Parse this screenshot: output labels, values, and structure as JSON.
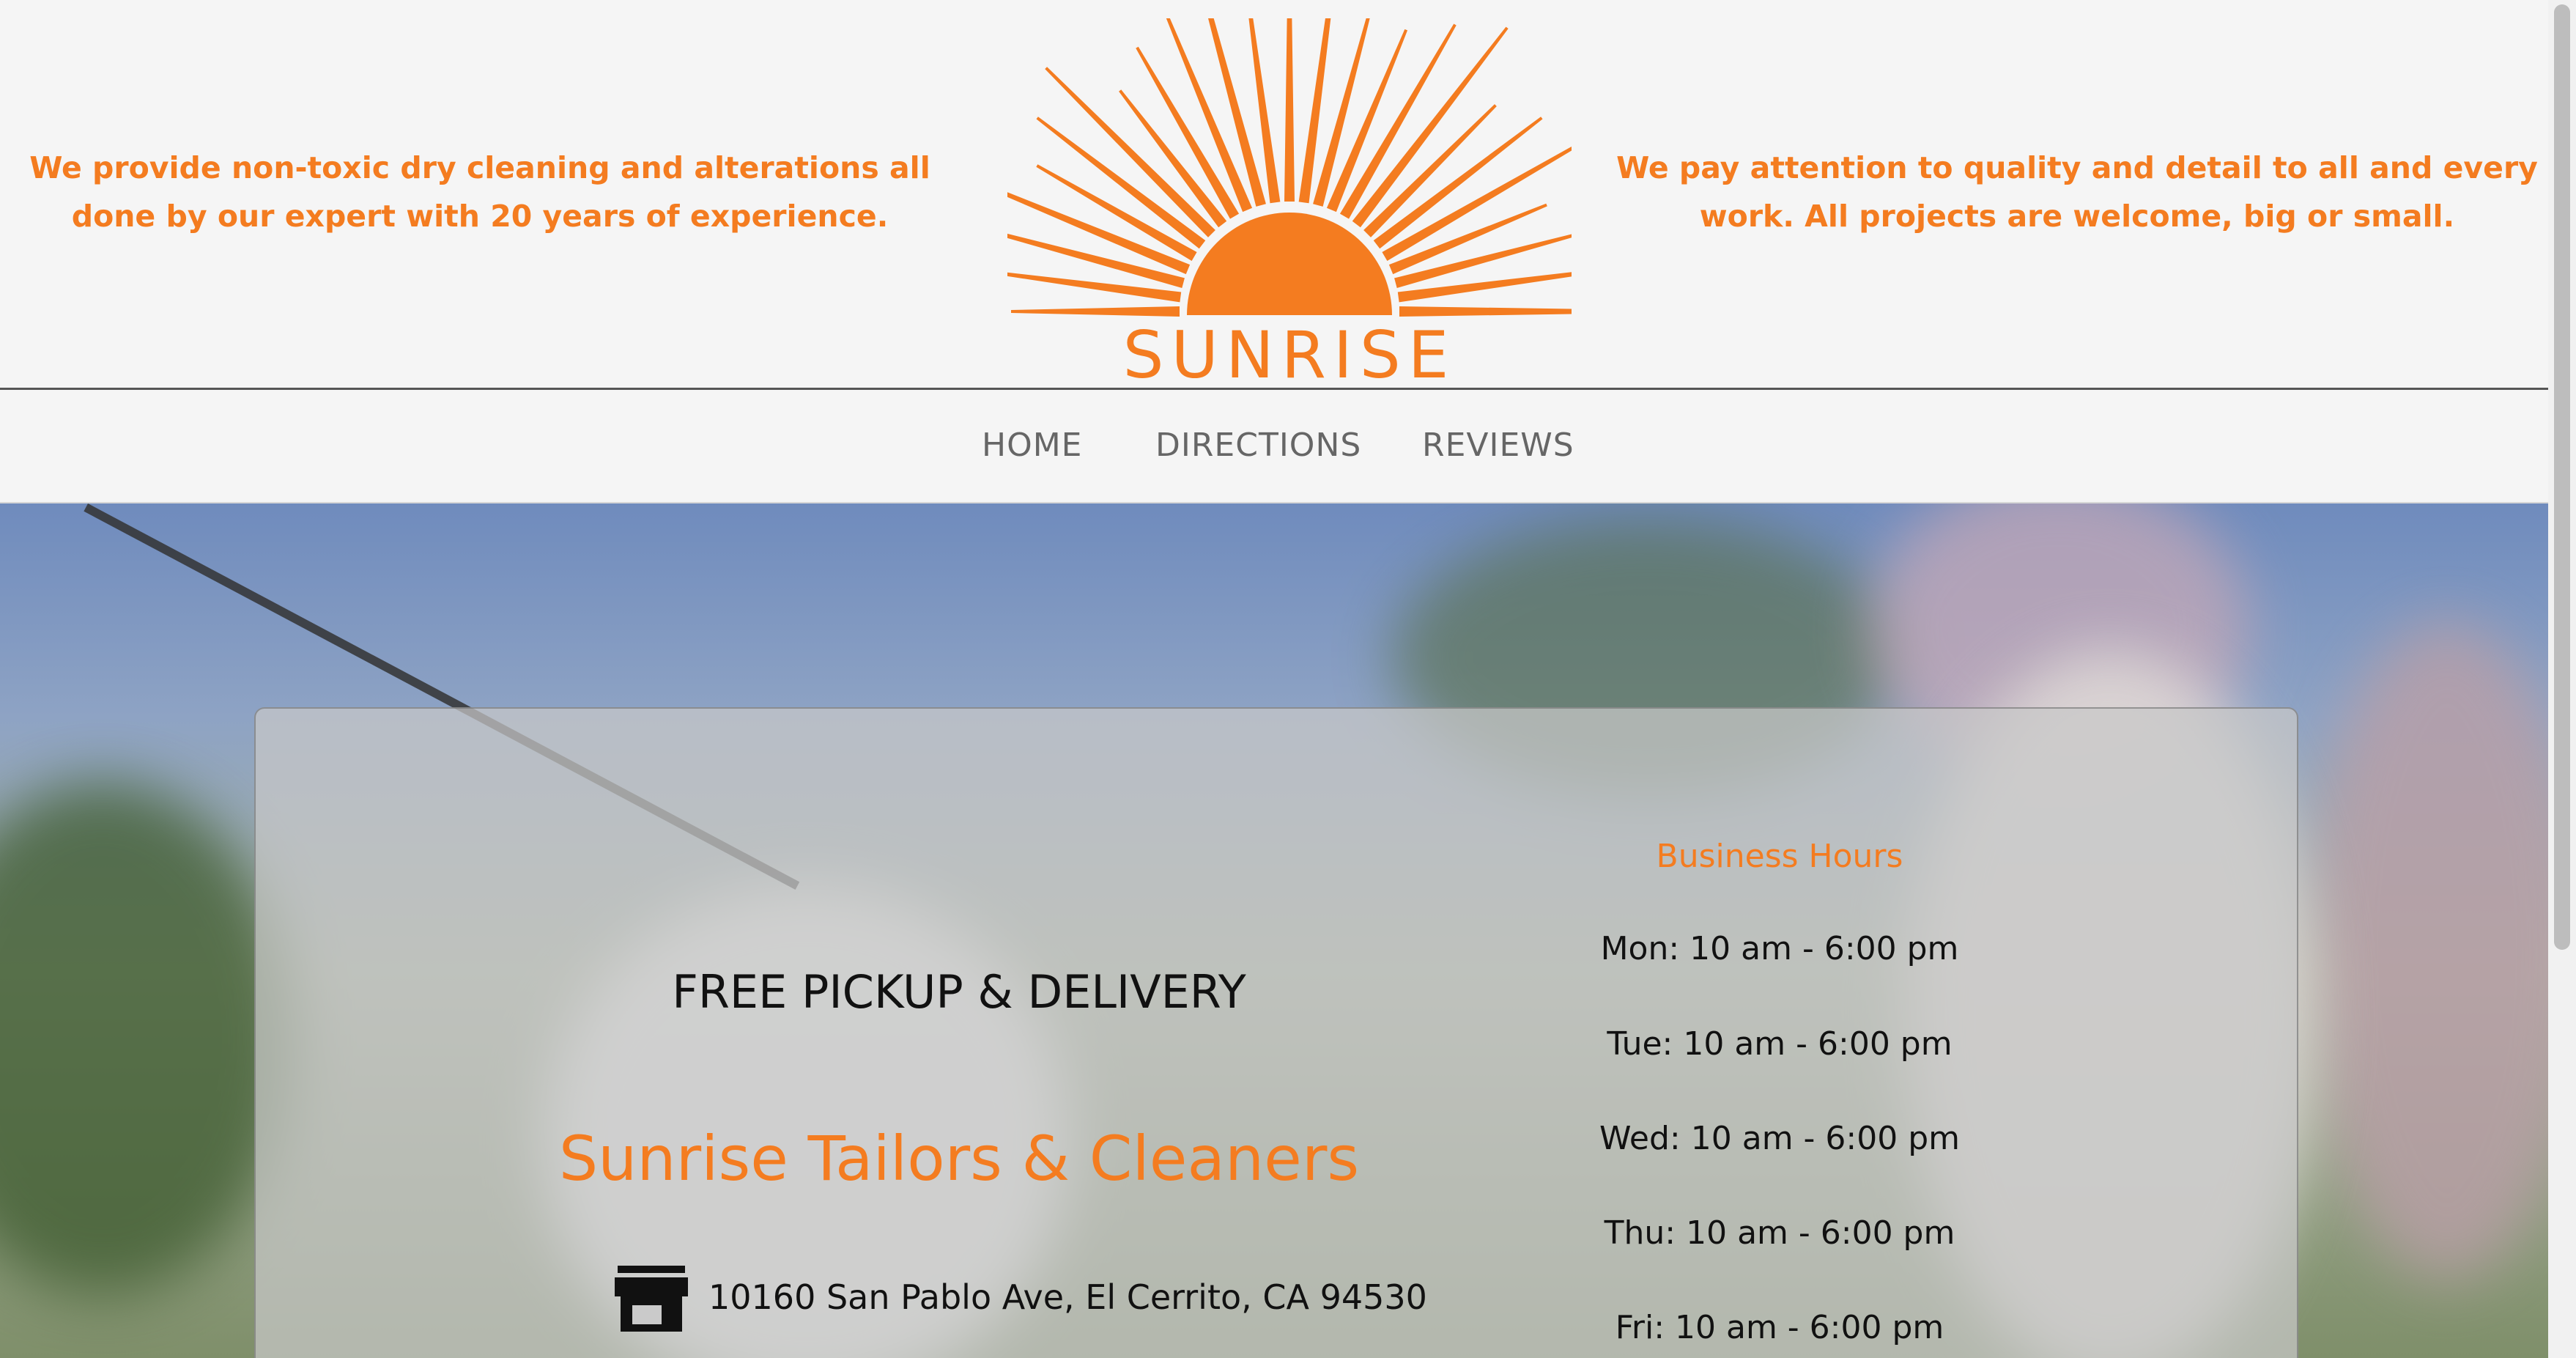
{
  "header": {
    "tagline_left": "We provide non-toxic dry cleaning and alterations all done by our expert with 20 years of experience.",
    "tagline_right": "We pay attention to quality and detail to all and every work. All projects are welcome, big or small.",
    "logo_text": "SUNRISE"
  },
  "nav": {
    "items": [
      {
        "label": "HOME"
      },
      {
        "label": "DIRECTIONS"
      },
      {
        "label": "REVIEWS"
      }
    ]
  },
  "hero": {
    "pickup_label": "FREE PICKUP & DELIVERY",
    "business_name": "Sunrise Tailors & Cleaners",
    "address_icon": "store-icon",
    "address": "10160 San Pablo Ave, El Cerrito, CA 94530",
    "hours_title": "Business Hours",
    "hours": [
      {
        "day": "Mon:",
        "time": " 10 am - 6:00 pm"
      },
      {
        "day": "Tue:",
        "time": " 10 am - 6:00 pm"
      },
      {
        "day": "Wed:",
        "time": " 10 am - 6:00 pm"
      },
      {
        "day": "Thu:",
        "time": " 10 am - 6:00 pm"
      },
      {
        "day": "Fri:",
        "time": " 10 am - 6:00 pm"
      }
    ]
  },
  "colors": {
    "accent": "#f47c20",
    "background": "#f5f5f5",
    "nav_text": "#666666"
  }
}
